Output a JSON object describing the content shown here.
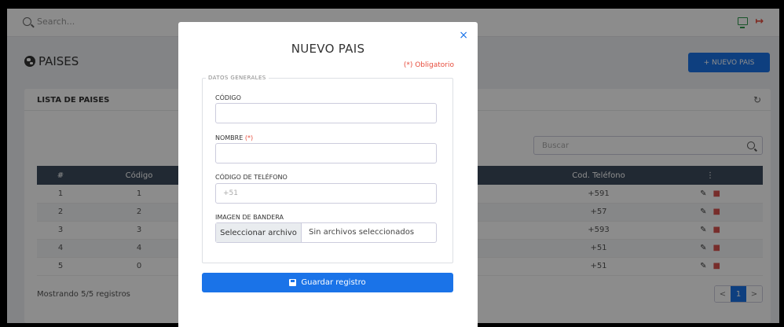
{
  "topbar": {
    "search_placeholder": "Search..."
  },
  "page": {
    "title": "PAISES",
    "new_button": "+ NUEVO PAIS"
  },
  "card": {
    "title": "LISTA DE PAISES",
    "search_placeholder": "Buscar",
    "columns": [
      "#",
      "Código",
      "",
      "Cod. Teléfono",
      "⋮"
    ],
    "rows": [
      {
        "n": "1",
        "codigo": "1",
        "telefono": "+591"
      },
      {
        "n": "2",
        "codigo": "2",
        "telefono": "+57"
      },
      {
        "n": "3",
        "codigo": "3",
        "telefono": "+593"
      },
      {
        "n": "4",
        "codigo": "4",
        "telefono": "+51"
      },
      {
        "n": "5",
        "codigo": "0",
        "telefono": "+51"
      }
    ],
    "footer": "Mostrando 5/5 registros",
    "pager": {
      "prev": "<",
      "current": "1",
      "next": ">"
    }
  },
  "modal": {
    "title": "NUEVO PAIS",
    "close": "×",
    "required_note": "(*) Obligatorio",
    "section_legend": "DATOS GENERALES",
    "fields": {
      "codigo_label": "CÓDIGO",
      "codigo_value": "",
      "nombre_label": "NOMBRE",
      "nombre_required": "(*)",
      "nombre_value": "",
      "telefono_label": "CÓDIGO DE TELÉFONO",
      "telefono_placeholder": "+51",
      "bandera_label": "IMAGEN DE BANDERA",
      "file_button": "Seleccionar archivo",
      "file_status": "Sin archivos seleccionados"
    },
    "save_button": "Guardar registro"
  },
  "colors": {
    "primary": "#1a73e8",
    "danger": "#e74c3c",
    "table_header": "#3d4b5e",
    "accent_green": "#2e9a4b"
  },
  "icons": [
    "search-icon",
    "monitor-icon",
    "logout-icon",
    "globe-icon",
    "refresh-icon",
    "close-icon",
    "pencil-icon",
    "trash-icon",
    "floppy-icon"
  ]
}
